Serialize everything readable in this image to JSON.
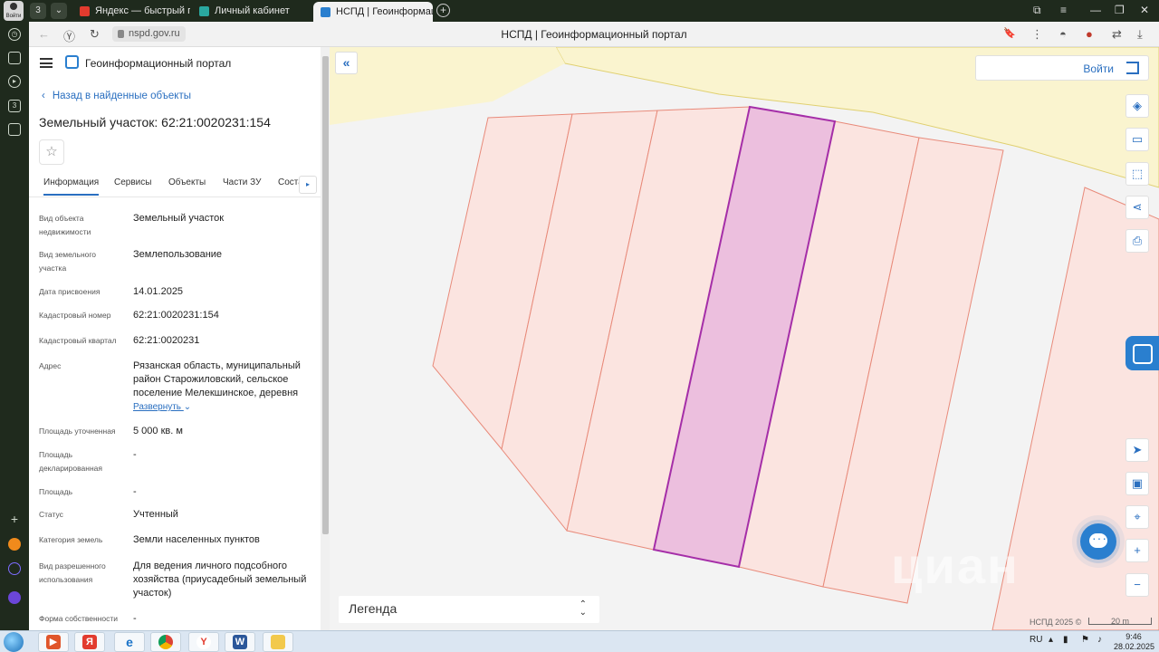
{
  "browser": {
    "profile_label": "Войти",
    "tab_count": "3",
    "tabs": [
      {
        "title": "Яндекс — быстрый поиск",
        "icon": "yandex-icon",
        "color": "#e23b2e"
      },
      {
        "title": "Личный кабинет",
        "icon": "cabinet-icon",
        "color": "#2aa8a0"
      },
      {
        "title": "НСПД | Геоинформаци",
        "icon": "nspd-icon",
        "color": "#2a7fcf",
        "active": true
      }
    ],
    "url": "nspd.gov.ru",
    "page_title": "НСПД | Геоинформационный портал"
  },
  "panel": {
    "portal_title": "Геоинформационный портал",
    "back_label": "Назад в найденные объекты",
    "object_title": "Земельный участок: 62:21:0020231:154",
    "tabs": [
      "Информация",
      "Сервисы",
      "Объекты",
      "Части ЗУ",
      "Соста"
    ],
    "fields": [
      {
        "label": "Вид объекта недвижимости",
        "value": "Земельный участок"
      },
      {
        "label": "Вид земельного участка",
        "value": "Землепользование"
      },
      {
        "label": "Дата присвоения",
        "value": "14.01.2025"
      },
      {
        "label": "Кадастровый номер",
        "value": "62:21:0020231:154"
      },
      {
        "label": "Кадастровый квартал",
        "value": "62:21:0020231"
      },
      {
        "label": "Адрес",
        "value": "Рязанская область, муниципальный район Старожиловский, сельское поселение Мелекшинское, деревня"
      },
      {
        "label": "Площадь уточненная",
        "value": "5 000 кв. м"
      },
      {
        "label": "Площадь декларированная",
        "value": "-"
      },
      {
        "label": "Площадь",
        "value": "-"
      },
      {
        "label": "Статус",
        "value": "Учтенный"
      },
      {
        "label": "Категория земель",
        "value": "Земли населенных пунктов"
      },
      {
        "label": "Вид разрешенного использования",
        "value": "Для ведения личного подсобного хозяйства (приусадебный земельный участок)"
      },
      {
        "label": "Форма собственности",
        "value": "-"
      }
    ],
    "expand_label": "Развернуть"
  },
  "map": {
    "login_label": "Войти",
    "legend_label": "Легенда",
    "copyright": "НСПД 2025 ©",
    "scale_label": "20 m",
    "watermark": "циан",
    "colors": {
      "parcel_fill": "#fbe4e0",
      "parcel_stroke": "#e88a7a",
      "selected_fill": "#ecbfde",
      "selected_stroke": "#a52ea8",
      "zone_fill": "#faf4cf",
      "zone_stroke": "#e0d070"
    }
  },
  "taskbar": {
    "lang": "RU",
    "time": "9:46",
    "date": "28.02.2025"
  }
}
